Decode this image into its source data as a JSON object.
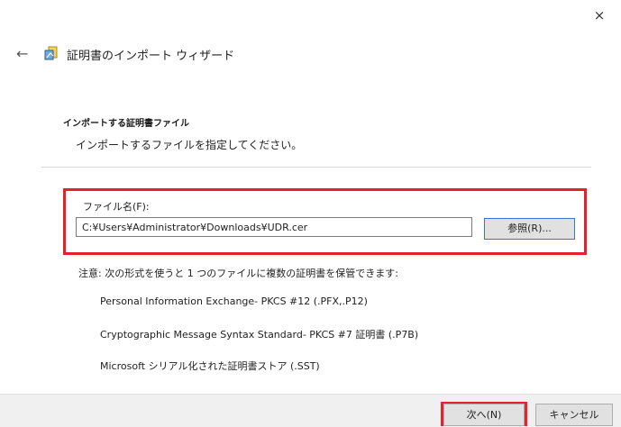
{
  "window": {
    "title": "証明書のインポート ウィザード",
    "close_glyph": "×",
    "back_glyph": "←"
  },
  "section": {
    "title": "インポートする証明書ファイル",
    "subtitle": "インポートするファイルを指定してください。"
  },
  "file": {
    "label": "ファイル名(F):",
    "value": "C:¥Users¥Administrator¥Downloads¥UDR.cer",
    "browse_label": "参照(R)..."
  },
  "note": "注意: 次の形式を使うと 1 つのファイルに複数の証明書を保管できます:",
  "formats": [
    "Personal Information Exchange- PKCS #12 (.PFX,.P12)",
    "Cryptographic Message Syntax Standard- PKCS #7 証明書 (.P7B)",
    "Microsoft シリアル化された証明書ストア (.SST)"
  ],
  "footer": {
    "next_label": "次へ(N)",
    "cancel_label": "キャンセル"
  },
  "colors": {
    "highlight": "#e2232e",
    "accent": "#3a72c8"
  },
  "icons": {
    "back": "back-arrow-icon",
    "wizard": "certificate-wizard-icon",
    "close": "close-icon"
  }
}
